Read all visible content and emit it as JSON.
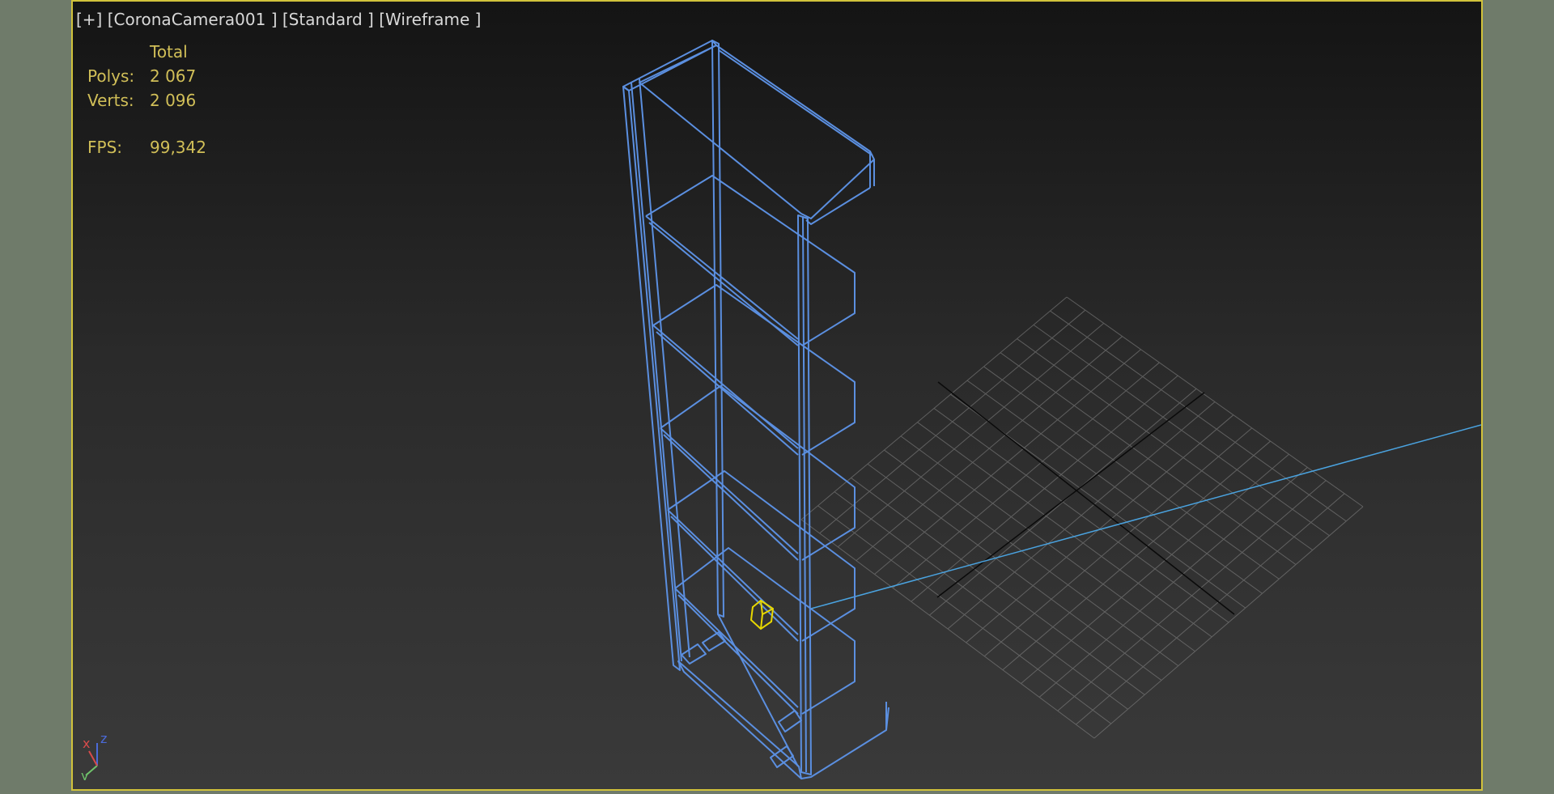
{
  "viewport": {
    "label": {
      "menu": "[+]",
      "camera": "[CoronaCamera001 ]",
      "mode": "[Standard ]",
      "shading": "[Wireframe ]"
    },
    "stats": {
      "header": "Total",
      "polys_label": "Polys:",
      "polys_value": "2 067",
      "verts_label": "Verts:",
      "verts_value": "2 096",
      "fps_label": "FPS:",
      "fps_value": "99,342"
    },
    "axis_gizmo": {
      "x": "x",
      "y": "y",
      "z": "z"
    }
  },
  "colors": {
    "border_active": "#d1c23b",
    "wireframe": "#5b8fe0",
    "grid": "#8a8a8a",
    "grid_axis": "#0a0a0a",
    "camera_line": "#4aa3e0",
    "selected": "#e8d800",
    "stats_text": "#d1bf58",
    "label_text": "#d8d8d8"
  },
  "icons": [
    "axis-gizmo-icon"
  ]
}
